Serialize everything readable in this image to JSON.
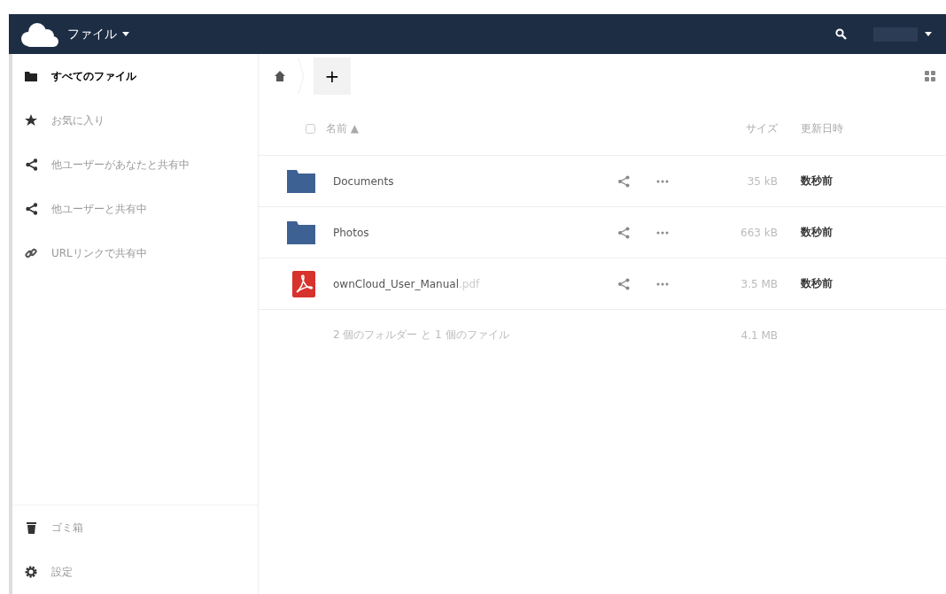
{
  "header": {
    "app_menu": "ファイル"
  },
  "sidebar": {
    "items": [
      {
        "label": "すべてのファイル",
        "selected": true
      },
      {
        "label": "お気に入り",
        "selected": false
      },
      {
        "label": "他ユーザーがあなたと共有中",
        "selected": false
      },
      {
        "label": "他ユーザーと共有中",
        "selected": false
      },
      {
        "label": "URLリンクで共有中",
        "selected": false
      }
    ],
    "bottom": [
      {
        "label": "ゴミ箱"
      },
      {
        "label": "設定"
      }
    ]
  },
  "toolbar": {
    "new_button": "+"
  },
  "table": {
    "select_all": {
      "checked": false
    },
    "columns": {
      "name": "名前",
      "sort_indicator": "▲",
      "size": "サイズ",
      "modified": "更新日時"
    },
    "rows": [
      {
        "kind": "folder",
        "name": "Documents",
        "size": "35 kB",
        "modified": "数秒前"
      },
      {
        "kind": "folder",
        "name": "Photos",
        "size": "663 kB",
        "modified": "数秒前"
      },
      {
        "kind": "pdf",
        "name": "ownCloud_User_Manual",
        "extension": ".pdf",
        "size": "3.5 MB",
        "modified": "数秒前"
      }
    ],
    "summary": {
      "text": "2 個のフォルダー と 1 個のファイル",
      "size": "4.1 MB"
    }
  }
}
